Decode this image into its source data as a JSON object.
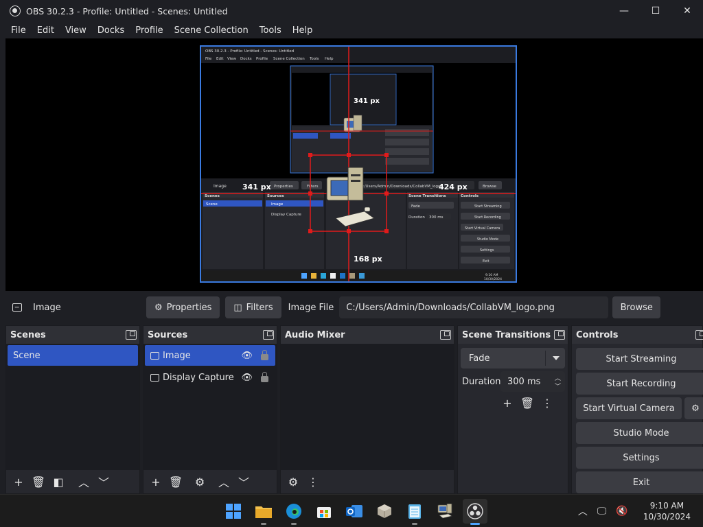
{
  "window": {
    "title": "OBS 30.2.3 - Profile: Untitled - Scenes: Untitled",
    "minimize": "—",
    "maximize": "☐",
    "close": "✕"
  },
  "menu": [
    "File",
    "Edit",
    "View",
    "Docks",
    "Profile",
    "Scene Collection",
    "Tools",
    "Help"
  ],
  "preview": {
    "measure_left": "341 px",
    "measure_right": "424 px",
    "measure_bottom": "168 px",
    "inner": {
      "title": "OBS 30.2.3 - Profile: Untitled - Scenes: Untitled",
      "menu": [
        "File",
        "Edit",
        "View",
        "Docks",
        "Profile",
        "Scene Collection",
        "Tools",
        "Help"
      ],
      "source_label": "Image",
      "properties": "Properties",
      "filters": "Filters",
      "path": "C:/Users/Admin/Downloads/CollabVM_logo",
      "browse": "Browse",
      "docks": [
        "Scenes",
        "Sources",
        "Scene Transitions",
        "Controls"
      ],
      "scene": "Scene",
      "sources": [
        "Image",
        "Display Capture"
      ],
      "transition": "Fade",
      "duration_label": "Duration",
      "duration": "300 ms",
      "controls": [
        "Start Streaming",
        "Start Recording",
        "Start Virtual Camera",
        "Studio Mode",
        "Settings",
        "Exit"
      ],
      "clock_time": "9:10 AM",
      "clock_date": "10/30/2024"
    }
  },
  "source_toolbar": {
    "name": "Image",
    "properties": "Properties",
    "filters": "Filters",
    "image_file_label": "Image File",
    "path": "C:/Users/Admin/Downloads/CollabVM_logo.png",
    "browse": "Browse"
  },
  "docks": {
    "scenes": {
      "title": "Scenes",
      "items": [
        "Scene"
      ]
    },
    "sources": {
      "title": "Sources",
      "items": [
        "Image",
        "Display Capture"
      ]
    },
    "mixer": {
      "title": "Audio Mixer"
    },
    "transitions": {
      "title": "Scene Transitions",
      "selected": "Fade",
      "duration_label": "Duration",
      "duration": "300 ms"
    },
    "controls": {
      "title": "Controls",
      "buttons": [
        "Start Streaming",
        "Start Recording",
        "Start Virtual Camera",
        "Studio Mode",
        "Settings",
        "Exit"
      ]
    }
  },
  "taskbar": {
    "time": "9:10 AM",
    "date": "10/30/2024"
  },
  "colors": {
    "accent": "#2f56c2",
    "preview_border": "#3a7ae0",
    "guide": "#e01b1b"
  }
}
